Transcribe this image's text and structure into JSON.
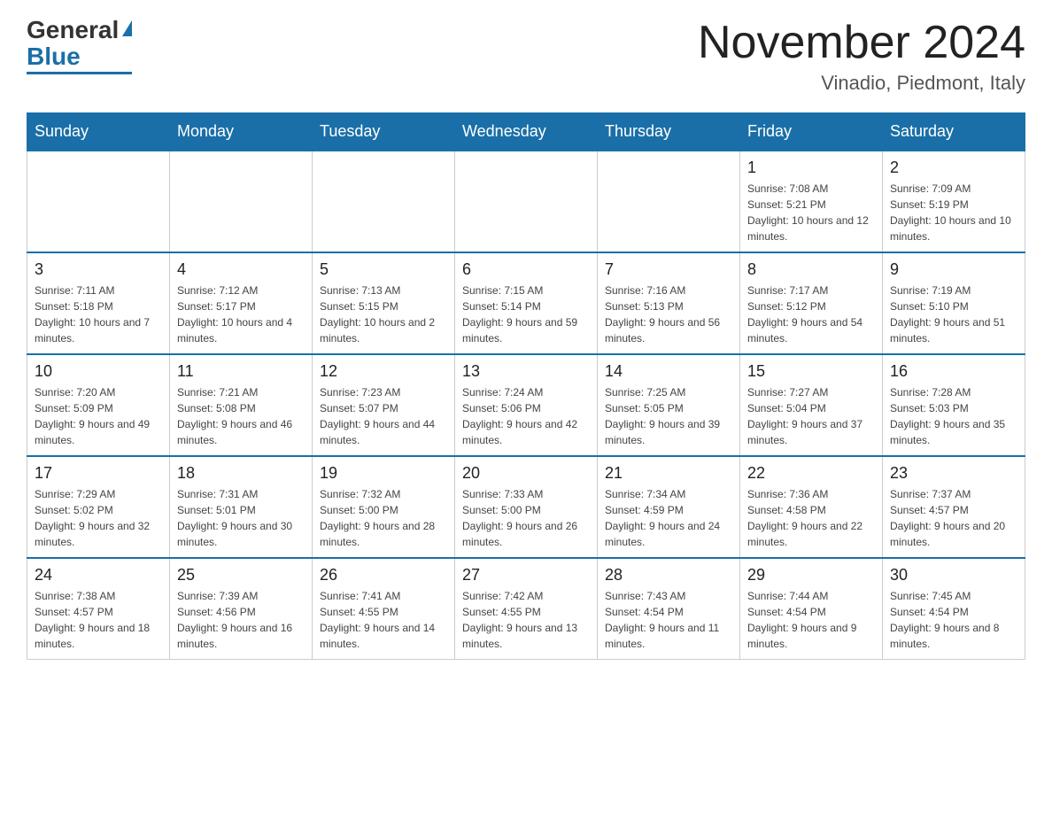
{
  "header": {
    "logo_general": "General",
    "logo_blue": "Blue",
    "month_title": "November 2024",
    "location": "Vinadio, Piedmont, Italy"
  },
  "days_of_week": [
    "Sunday",
    "Monday",
    "Tuesday",
    "Wednesday",
    "Thursday",
    "Friday",
    "Saturday"
  ],
  "weeks": [
    [
      {
        "day": "",
        "info": ""
      },
      {
        "day": "",
        "info": ""
      },
      {
        "day": "",
        "info": ""
      },
      {
        "day": "",
        "info": ""
      },
      {
        "day": "",
        "info": ""
      },
      {
        "day": "1",
        "info": "Sunrise: 7:08 AM\nSunset: 5:21 PM\nDaylight: 10 hours and 12 minutes."
      },
      {
        "day": "2",
        "info": "Sunrise: 7:09 AM\nSunset: 5:19 PM\nDaylight: 10 hours and 10 minutes."
      }
    ],
    [
      {
        "day": "3",
        "info": "Sunrise: 7:11 AM\nSunset: 5:18 PM\nDaylight: 10 hours and 7 minutes."
      },
      {
        "day": "4",
        "info": "Sunrise: 7:12 AM\nSunset: 5:17 PM\nDaylight: 10 hours and 4 minutes."
      },
      {
        "day": "5",
        "info": "Sunrise: 7:13 AM\nSunset: 5:15 PM\nDaylight: 10 hours and 2 minutes."
      },
      {
        "day": "6",
        "info": "Sunrise: 7:15 AM\nSunset: 5:14 PM\nDaylight: 9 hours and 59 minutes."
      },
      {
        "day": "7",
        "info": "Sunrise: 7:16 AM\nSunset: 5:13 PM\nDaylight: 9 hours and 56 minutes."
      },
      {
        "day": "8",
        "info": "Sunrise: 7:17 AM\nSunset: 5:12 PM\nDaylight: 9 hours and 54 minutes."
      },
      {
        "day": "9",
        "info": "Sunrise: 7:19 AM\nSunset: 5:10 PM\nDaylight: 9 hours and 51 minutes."
      }
    ],
    [
      {
        "day": "10",
        "info": "Sunrise: 7:20 AM\nSunset: 5:09 PM\nDaylight: 9 hours and 49 minutes."
      },
      {
        "day": "11",
        "info": "Sunrise: 7:21 AM\nSunset: 5:08 PM\nDaylight: 9 hours and 46 minutes."
      },
      {
        "day": "12",
        "info": "Sunrise: 7:23 AM\nSunset: 5:07 PM\nDaylight: 9 hours and 44 minutes."
      },
      {
        "day": "13",
        "info": "Sunrise: 7:24 AM\nSunset: 5:06 PM\nDaylight: 9 hours and 42 minutes."
      },
      {
        "day": "14",
        "info": "Sunrise: 7:25 AM\nSunset: 5:05 PM\nDaylight: 9 hours and 39 minutes."
      },
      {
        "day": "15",
        "info": "Sunrise: 7:27 AM\nSunset: 5:04 PM\nDaylight: 9 hours and 37 minutes."
      },
      {
        "day": "16",
        "info": "Sunrise: 7:28 AM\nSunset: 5:03 PM\nDaylight: 9 hours and 35 minutes."
      }
    ],
    [
      {
        "day": "17",
        "info": "Sunrise: 7:29 AM\nSunset: 5:02 PM\nDaylight: 9 hours and 32 minutes."
      },
      {
        "day": "18",
        "info": "Sunrise: 7:31 AM\nSunset: 5:01 PM\nDaylight: 9 hours and 30 minutes."
      },
      {
        "day": "19",
        "info": "Sunrise: 7:32 AM\nSunset: 5:00 PM\nDaylight: 9 hours and 28 minutes."
      },
      {
        "day": "20",
        "info": "Sunrise: 7:33 AM\nSunset: 5:00 PM\nDaylight: 9 hours and 26 minutes."
      },
      {
        "day": "21",
        "info": "Sunrise: 7:34 AM\nSunset: 4:59 PM\nDaylight: 9 hours and 24 minutes."
      },
      {
        "day": "22",
        "info": "Sunrise: 7:36 AM\nSunset: 4:58 PM\nDaylight: 9 hours and 22 minutes."
      },
      {
        "day": "23",
        "info": "Sunrise: 7:37 AM\nSunset: 4:57 PM\nDaylight: 9 hours and 20 minutes."
      }
    ],
    [
      {
        "day": "24",
        "info": "Sunrise: 7:38 AM\nSunset: 4:57 PM\nDaylight: 9 hours and 18 minutes."
      },
      {
        "day": "25",
        "info": "Sunrise: 7:39 AM\nSunset: 4:56 PM\nDaylight: 9 hours and 16 minutes."
      },
      {
        "day": "26",
        "info": "Sunrise: 7:41 AM\nSunset: 4:55 PM\nDaylight: 9 hours and 14 minutes."
      },
      {
        "day": "27",
        "info": "Sunrise: 7:42 AM\nSunset: 4:55 PM\nDaylight: 9 hours and 13 minutes."
      },
      {
        "day": "28",
        "info": "Sunrise: 7:43 AM\nSunset: 4:54 PM\nDaylight: 9 hours and 11 minutes."
      },
      {
        "day": "29",
        "info": "Sunrise: 7:44 AM\nSunset: 4:54 PM\nDaylight: 9 hours and 9 minutes."
      },
      {
        "day": "30",
        "info": "Sunrise: 7:45 AM\nSunset: 4:54 PM\nDaylight: 9 hours and 8 minutes."
      }
    ]
  ]
}
